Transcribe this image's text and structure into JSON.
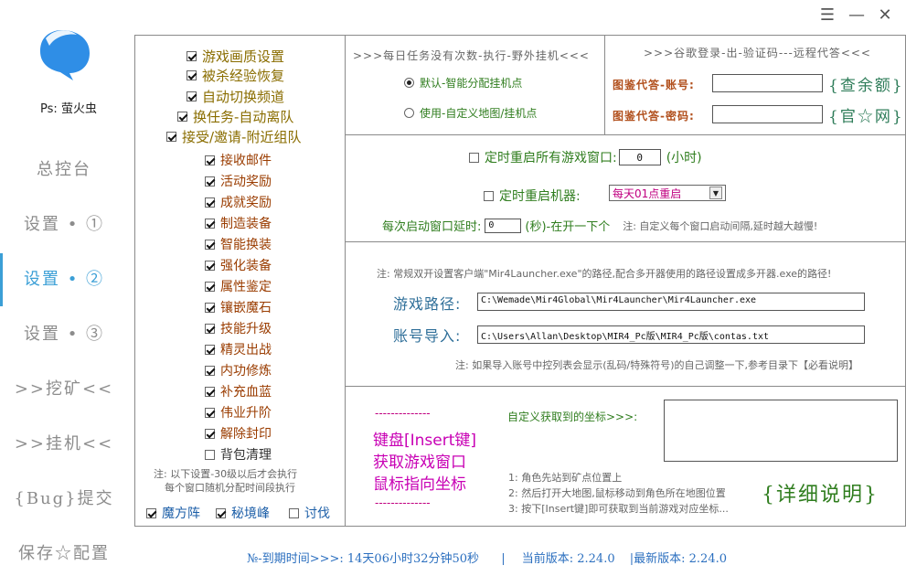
{
  "window": {
    "menu_icon": "hamburger-icon",
    "minimize_icon": "minimize-icon",
    "close_icon": "close-icon"
  },
  "sidebar": {
    "tips": "Ps: 萤火虫",
    "items": [
      {
        "label": "总控台"
      },
      {
        "label": "设置 • ①"
      },
      {
        "label": "设置 • ②"
      },
      {
        "label": "设置 • ③"
      },
      {
        "label": ">>挖矿<<"
      },
      {
        "label": ">>挂机<<"
      },
      {
        "label": "{Bug}提交"
      },
      {
        "label": "保存☆配置"
      }
    ],
    "active_index": 2
  },
  "options": {
    "main": [
      {
        "label": "游戏画质设置",
        "checked": true
      },
      {
        "label": "被杀经验恢复",
        "checked": true
      },
      {
        "label": "自动切换频道",
        "checked": true
      },
      {
        "label": "换任务-自动离队",
        "checked": true
      },
      {
        "label": "接受/邀请-附近组队",
        "checked": true
      }
    ],
    "sub": [
      {
        "label": "接收邮件",
        "checked": true
      },
      {
        "label": "活动奖励",
        "checked": true
      },
      {
        "label": "成就奖励",
        "checked": true
      },
      {
        "label": "制造装备",
        "checked": true
      },
      {
        "label": "智能换装",
        "checked": true
      },
      {
        "label": "强化装备",
        "checked": true
      },
      {
        "label": "属性鉴定",
        "checked": true
      },
      {
        "label": "镶嵌魔石",
        "checked": true
      },
      {
        "label": "技能升级",
        "checked": true
      },
      {
        "label": "精灵出战",
        "checked": true
      },
      {
        "label": "内功修炼",
        "checked": true
      },
      {
        "label": "补充血蓝",
        "checked": true
      },
      {
        "label": "伟业升阶",
        "checked": true
      },
      {
        "label": "解除封印",
        "checked": true
      },
      {
        "label": "背包清理",
        "checked": false
      }
    ],
    "note_line1": "注: 以下设置-30级以后才会执行",
    "note_line2": "每个窗口随机分配时间段执行",
    "bottom": [
      {
        "label": "魔方阵",
        "checked": true
      },
      {
        "label": "秘境峰",
        "checked": true
      },
      {
        "label": "讨伐",
        "checked": false
      }
    ]
  },
  "daily": {
    "title": ">>>每日任务没有次数-执行-野外挂机<<<",
    "radio1": "默认-智能分配挂机点",
    "radio2": "使用-自定义地图/挂机点"
  },
  "google": {
    "title": ">>>谷歌登录-出-验证码---远程代答<<<",
    "account_label": "图鉴代答-账号:",
    "password_label": "图鉴代答-密码:",
    "account_value": "",
    "password_value": "",
    "query_link": "{查余额}",
    "official_link": "{官☆网}"
  },
  "restart": {
    "restart_windows_label": "定时重启所有游戏窗口:",
    "restart_windows_value": "0",
    "restart_windows_unit": "(小时)",
    "restart_machine_label": "定时重启机器:",
    "restart_machine_option": "每天01点重启",
    "delay_label": "每次启动窗口延时:",
    "delay_value": "0",
    "delay_unit": "(秒)-在开一下个",
    "delay_note": "注: 自定义每个窗口启动间隔,延时越大越慢!"
  },
  "paths": {
    "note": "注: 常规双开设置客户端\"Mir4Launcher.exe\"的路径,配合多开器使用的路径设置成多开器.exe的路径!",
    "game_path_label": "游戏路径:",
    "game_path_value": "C:\\Wemade\\Mir4Global\\Mir4Launcher\\Mir4Launcher.exe",
    "account_import_label": "账号导入:",
    "account_import_value": "C:\\Users\\Allan\\Desktop\\MIR4_Pc版\\MIR4_Pc版\\contas.txt",
    "footer_note": "注: 如果导入账号中控列表会显示(乱码/特殊符号)的自己调整一下,参考目录下【必看说明】"
  },
  "coords": {
    "dashes": "--------------",
    "line1": "键盘[Insert键]",
    "line2": "获取游戏窗口",
    "line3": "鼠标指向坐标",
    "label": "自定义获取到的坐标>>>:",
    "value": "",
    "step1": "1: 角色先站到矿点位置上",
    "step2": "2: 然后打开大地图,鼠标移动到角色所在地图位置",
    "step3": "3: 按下[Insert键]即可获取到当前游戏对应坐标...",
    "detail_link": "{详细说明}"
  },
  "status": {
    "expiry": "№-到期时间>>>: 14天06小时32分钟50秒",
    "sep": "|",
    "current_version": "当前版本: 2.24.0",
    "latest_version": "|最新版本: 2.24.0"
  },
  "colors": {
    "accent": "#3b9fd6",
    "bubble": "#2f8ee6"
  }
}
